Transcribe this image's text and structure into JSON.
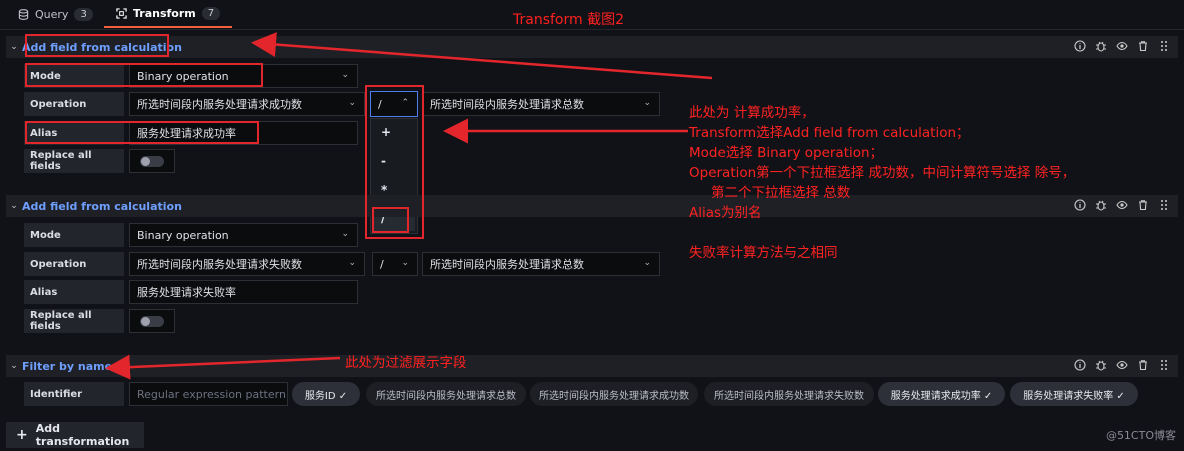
{
  "tabs": [
    {
      "label": "Query",
      "count": "3"
    },
    {
      "label": "Transform",
      "count": "7"
    }
  ],
  "annotation_title": "Transform 截图2",
  "transforms": [
    {
      "title": "Add field from calculation",
      "mode_label": "Mode",
      "mode_value": "Binary operation",
      "operation_label": "Operation",
      "left_field": "所选时间段内服务处理请求成功数",
      "operator": "/",
      "right_field": "所选时间段内服务处理请求总数",
      "alias_label": "Alias",
      "alias_value": "服务处理请求成功率",
      "replace_label": "Replace all fields"
    },
    {
      "title": "Add field from calculation",
      "mode_label": "Mode",
      "mode_value": "Binary operation",
      "operation_label": "Operation",
      "left_field": "所选时间段内服务处理请求失败数",
      "operator": "/",
      "right_field": "所选时间段内服务处理请求总数",
      "alias_label": "Alias",
      "alias_value": "服务处理请求失败率",
      "replace_label": "Replace all fields"
    },
    {
      "title": "Filter by name",
      "identifier_label": "Identifier",
      "identifier_placeholder": "Regular expression pattern"
    }
  ],
  "operator_menu": [
    "+",
    "-",
    "*",
    "/"
  ],
  "chips": [
    {
      "label": "服务ID ✓",
      "selected": true
    },
    {
      "label": "所选时间段内服务处理请求总数",
      "selected": false
    },
    {
      "label": "所选时间段内服务处理请求成功数",
      "selected": false
    },
    {
      "label": "所选时间段内服务处理请求失败数",
      "selected": false
    },
    {
      "label": "服务处理请求成功率 ✓",
      "selected": true
    },
    {
      "label": "服务处理请求失败率 ✓",
      "selected": true
    }
  ],
  "notes": [
    "此处为 计算成功率，",
    "Transform选择Add field from calculation；",
    "Mode选择 Binary operation；",
    "Operation第一个下拉框选择 成功数，中间计算符号选择 除号，",
    "第二个下拉框选择 总数",
    "Alias为别名",
    "",
    "失败率计算方法与之相同"
  ],
  "filter_note": "此处为过滤展示字段",
  "add_transformation": "Add transformation",
  "watermark": "@51CTO博客",
  "colors": {
    "accent_blue": "#6e9fff",
    "tab_underline": "#f55f3e",
    "annotation_red": "#e3262b",
    "background": "#111217"
  }
}
